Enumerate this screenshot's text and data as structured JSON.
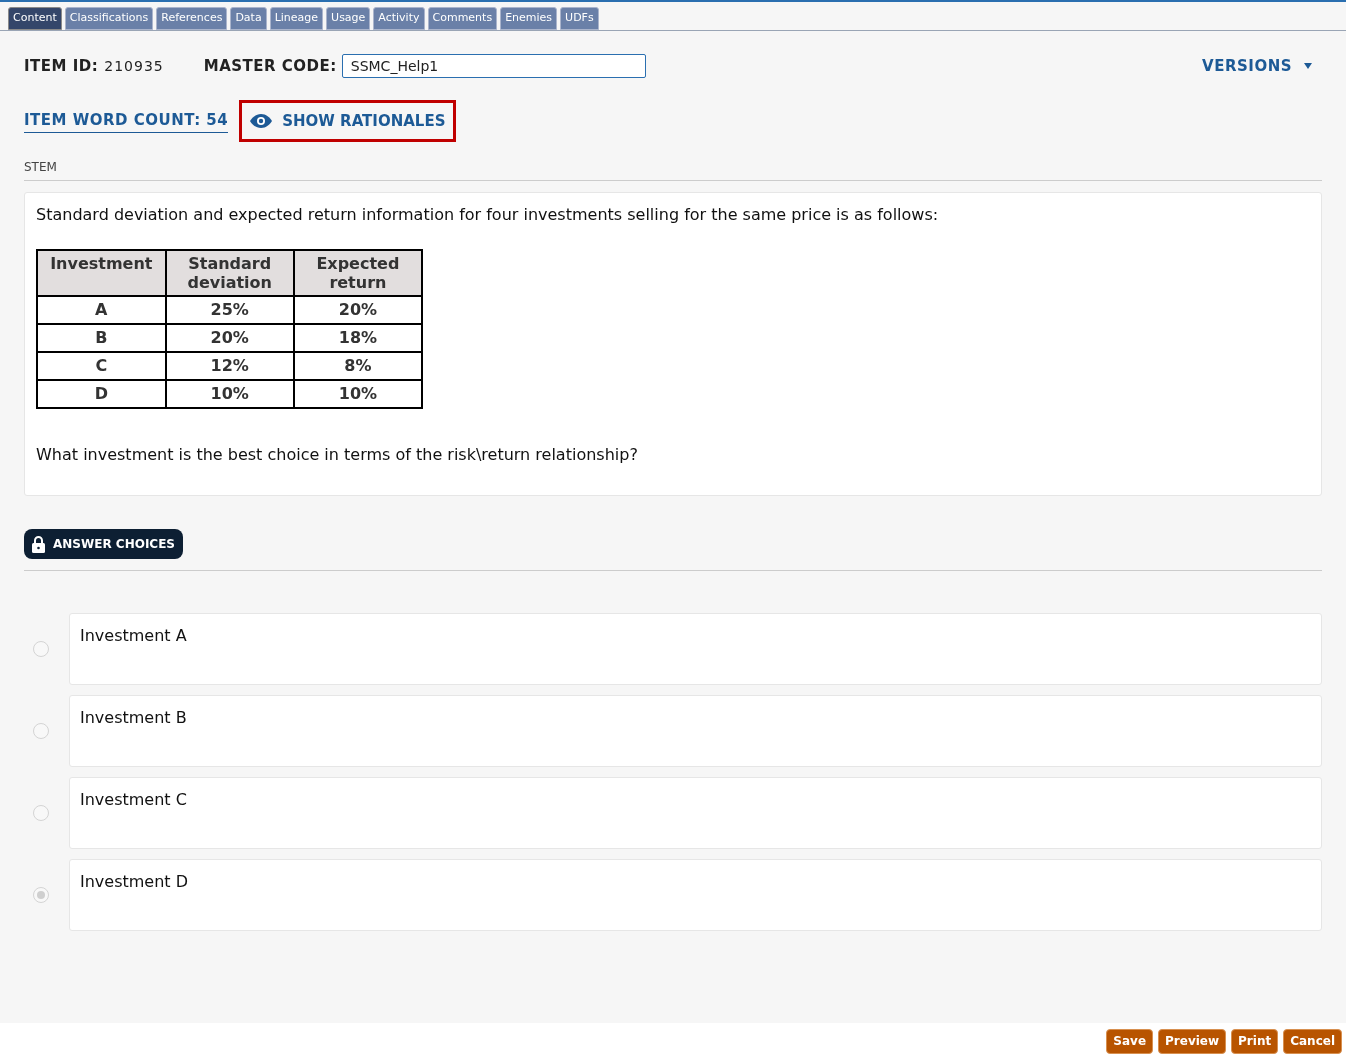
{
  "tabs": [
    {
      "label": "Content",
      "selected": true
    },
    {
      "label": "Classifications",
      "selected": false
    },
    {
      "label": "References",
      "selected": false
    },
    {
      "label": "Data",
      "selected": false
    },
    {
      "label": "Lineage",
      "selected": false
    },
    {
      "label": "Usage",
      "selected": false
    },
    {
      "label": "Activity",
      "selected": false
    },
    {
      "label": "Comments",
      "selected": false
    },
    {
      "label": "Enemies",
      "selected": false
    },
    {
      "label": "UDFs",
      "selected": false
    }
  ],
  "item_id": {
    "label": "ITEM ID:",
    "value": "210935"
  },
  "master_code": {
    "label": "MASTER CODE:",
    "value": "SSMC_Help1"
  },
  "versions": "VERSIONS",
  "word_count": "ITEM WORD COUNT: 54",
  "show_rationales": "SHOW RATIONALES",
  "stem": {
    "label": "STEM",
    "intro": "Standard deviation and expected return information for four investments selling for the same price is as follows:",
    "table": {
      "columns": [
        "Investment",
        "Standard deviation",
        "Expected return"
      ],
      "rows": [
        [
          "A",
          "25%",
          "20%"
        ],
        [
          "B",
          "20%",
          "18%"
        ],
        [
          "C",
          "12%",
          "8%"
        ],
        [
          "D",
          "10%",
          "10%"
        ]
      ]
    },
    "question": "What investment is the best choice in terms of the risk\\return relationship?"
  },
  "answer_choices": {
    "label": "ANSWER CHOICES",
    "choices": [
      {
        "text": "Investment A",
        "selected": false
      },
      {
        "text": "Investment B",
        "selected": false
      },
      {
        "text": "Investment C",
        "selected": false
      },
      {
        "text": "Investment D",
        "selected": true
      }
    ]
  },
  "buttons": [
    "Save",
    "Preview",
    "Print",
    "Cancel"
  ]
}
